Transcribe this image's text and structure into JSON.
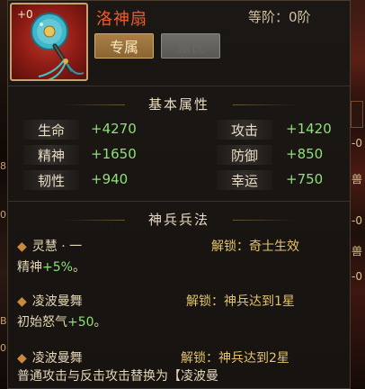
{
  "item": {
    "level": "+0",
    "name": "洛神扇",
    "rank_label": "等阶：",
    "rank_value": "0阶",
    "tag_exclusive": "专属",
    "tag_owner": "甄氏",
    "icon": "fan-icon"
  },
  "base_section": {
    "title": "基本属性",
    "stats": [
      {
        "label": "生命",
        "value": "+4270"
      },
      {
        "label": "攻击",
        "value": "+1420"
      },
      {
        "label": "精神",
        "value": "+1650"
      },
      {
        "label": "防御",
        "value": "+850"
      },
      {
        "label": "韧性",
        "value": "+940"
      },
      {
        "label": "幸运",
        "value": "+750"
      }
    ]
  },
  "skills_section": {
    "title": "神兵兵法",
    "skills": [
      {
        "name": "灵慧 · 一",
        "unlock": "解锁：奇士生效",
        "desc_prefix": "精神",
        "desc_value": "+5%",
        "desc_suffix": "。"
      },
      {
        "name": "凌波曼舞",
        "unlock": "解锁：神兵达到1星",
        "desc_prefix": "初始怒气",
        "desc_value": "+50",
        "desc_suffix": "。"
      },
      {
        "name": "凌波曼舞",
        "unlock": "解锁：神兵达到2星",
        "desc_prefix": "普通攻击与反击攻击替换为【凌波曼",
        "desc_value": "",
        "desc_suffix": ""
      }
    ]
  },
  "edge": {
    "left_glyphs": [
      "8",
      "0",
      "B",
      "0"
    ],
    "right_glyphs": [
      "-0",
      "兽",
      "-0",
      "兽",
      "-0"
    ]
  },
  "colors": {
    "item_name": "#f35b2a",
    "stat_value": "#8ee07a",
    "unlock": "#e2c36c"
  }
}
